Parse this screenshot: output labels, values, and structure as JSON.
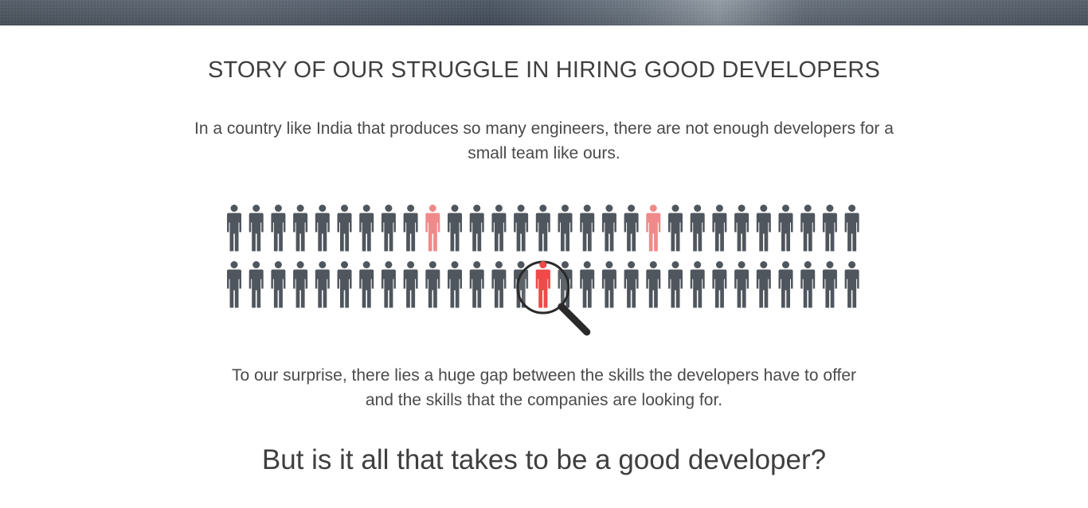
{
  "story": {
    "title": "STORY OF OUR STRUGGLE IN HIRING GOOD DEVELOPERS",
    "intro_line_1": "In a country like India that produces so many engineers, there are not enough developers for a",
    "intro_line_2": "small team like ours.",
    "gap_line_1": "To our surprise, there lies a huge gap between the skills the developers have to offer",
    "gap_line_2": "and the skills that the companies are looking for.",
    "question": "But is it all that takes to be a good developer?"
  },
  "illustration": {
    "people_per_row": 29,
    "rows": 2,
    "highlighted_top_row": [
      10,
      20
    ],
    "found_person_bottom_row": 15,
    "colors": {
      "person": "#4f565d",
      "highlight": "#f08a8a",
      "found": "#ef4a4a",
      "lens_ring": "#2a2a2a"
    },
    "magnifier_icon": "magnifying-glass-icon",
    "person_icon": "person-icon"
  }
}
